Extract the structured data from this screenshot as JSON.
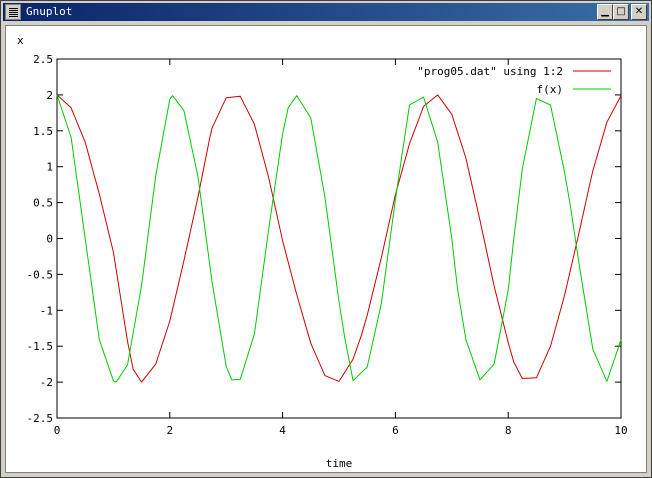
{
  "window": {
    "title": "Gnuplot",
    "buttons": {
      "minimize": "▁",
      "maximize": "□",
      "close": "✕"
    }
  },
  "chart_data": {
    "type": "line",
    "xlabel": "time",
    "ylabel": "x",
    "xlim": [
      0,
      10
    ],
    "ylim": [
      -2.5,
      2.5
    ],
    "xticks": [
      0,
      2,
      4,
      6,
      8,
      10
    ],
    "yticks": [
      -2.5,
      -2,
      -1.5,
      -1,
      -0.5,
      0,
      0.5,
      1,
      1.5,
      2,
      2.5
    ],
    "xtick_labels": [
      "0",
      "2",
      "4",
      "6",
      "8",
      "10"
    ],
    "ytick_labels": [
      "-2.5",
      "-2",
      "-1.5",
      "-1",
      "-0.5",
      "0",
      "0.5",
      "1",
      "1.5",
      "2",
      "2.5"
    ],
    "grid": false,
    "legend_position": "top-right",
    "series": [
      {
        "name": "\"prog05.dat\" using 1:2",
        "color": "#cc0000",
        "x": [
          0,
          0.25,
          0.5,
          0.75,
          1.0,
          1.25,
          1.35,
          1.5,
          1.75,
          2.0,
          2.25,
          2.5,
          2.7,
          2.75,
          3.0,
          3.25,
          3.5,
          3.75,
          4.0,
          4.05,
          4.25,
          4.5,
          4.75,
          5.0,
          5.25,
          5.4,
          5.5,
          5.75,
          6.0,
          6.25,
          6.5,
          6.75,
          7.0,
          7.25,
          7.5,
          7.75,
          8.0,
          8.1,
          8.25,
          8.5,
          8.75,
          9.0,
          9.25,
          9.45,
          9.5,
          9.75,
          10.0
        ],
        "y": [
          2.0,
          1.82,
          1.34,
          0.62,
          -0.19,
          -1.43,
          -1.82,
          -2.0,
          -1.75,
          -1.15,
          -0.31,
          0.58,
          1.37,
          1.54,
          1.96,
          1.98,
          1.59,
          0.86,
          -0.03,
          -0.18,
          -0.78,
          -1.46,
          -1.91,
          -1.99,
          -1.68,
          -1.34,
          -1.07,
          -0.27,
          0.61,
          1.32,
          1.84,
          2.0,
          1.73,
          1.12,
          0.25,
          -0.66,
          -1.45,
          -1.72,
          -1.95,
          -1.94,
          -1.5,
          -0.79,
          0.06,
          0.77,
          0.94,
          1.62,
          1.99
        ]
      },
      {
        "name": "f(x)",
        "color": "#00cc00",
        "x": [
          0,
          0.25,
          0.5,
          0.75,
          1.0,
          1.05,
          1.25,
          1.5,
          1.75,
          2.0,
          2.05,
          2.25,
          2.5,
          2.75,
          3.0,
          3.1,
          3.25,
          3.5,
          3.75,
          4.0,
          4.1,
          4.25,
          4.5,
          4.75,
          5.0,
          5.1,
          5.25,
          5.5,
          5.75,
          6.0,
          6.1,
          6.25,
          6.5,
          6.75,
          7.0,
          7.1,
          7.25,
          7.5,
          7.75,
          8.0,
          8.1,
          8.25,
          8.5,
          8.75,
          9.0,
          9.1,
          9.25,
          9.5,
          9.75,
          10.0
        ],
        "y": [
          2.0,
          1.41,
          0.0,
          -1.41,
          -1.98,
          -2.0,
          -1.76,
          -0.65,
          0.87,
          1.94,
          1.99,
          1.78,
          0.86,
          -0.61,
          -1.78,
          -1.97,
          -1.96,
          -1.33,
          0.11,
          1.46,
          1.82,
          1.99,
          1.68,
          0.58,
          -0.88,
          -1.37,
          -1.98,
          -1.79,
          -0.91,
          0.54,
          1.07,
          1.86,
          1.97,
          1.34,
          0.0,
          -0.69,
          -1.41,
          -1.97,
          -1.75,
          -0.72,
          0.0,
          0.97,
          1.95,
          1.86,
          0.92,
          0.47,
          -0.32,
          -1.54,
          -1.99,
          -1.41
        ]
      }
    ]
  }
}
